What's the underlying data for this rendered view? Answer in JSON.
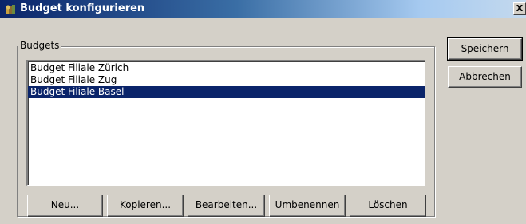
{
  "window": {
    "title": "Budget konfigurieren",
    "close_label": "X",
    "icon": "budget-app-icon"
  },
  "group": {
    "label": "Budgets"
  },
  "budgets": [
    {
      "label": "Budget Filiale Zürich",
      "selected": false
    },
    {
      "label": "Budget Filiale Zug",
      "selected": false
    },
    {
      "label": "Budget Filiale Basel",
      "selected": true
    }
  ],
  "list_buttons": {
    "new": "Neu...",
    "copy": "Kopieren...",
    "edit": "Bearbeiten...",
    "rename": "Umbenennen",
    "delete": "Löschen"
  },
  "dialog_buttons": {
    "save": "Speichern",
    "cancel": "Abbrechen"
  },
  "colors": {
    "selection": "#0a246a",
    "dialog_bg": "#d4d0c8"
  }
}
